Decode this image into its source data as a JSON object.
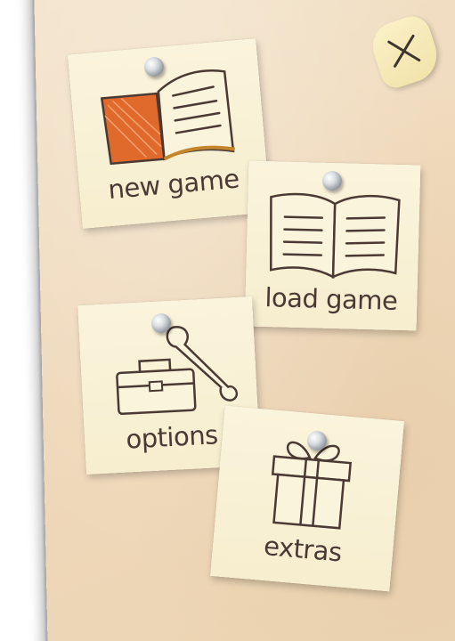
{
  "menu": {
    "new_game": "new game",
    "load_game": "load game",
    "options": "options",
    "extras": "extras"
  },
  "icons": {
    "new_game": "open-book-icon",
    "load_game": "open-book-icon",
    "options": "toolbox-wrench-icon",
    "extras": "gift-box-icon",
    "close": "close-icon",
    "pin": "pushpin-icon"
  },
  "colors": {
    "book_accent": "#e06a2c",
    "ink": "#4a3a33",
    "note": "#f9f1d6",
    "board": "#efd9bb"
  }
}
